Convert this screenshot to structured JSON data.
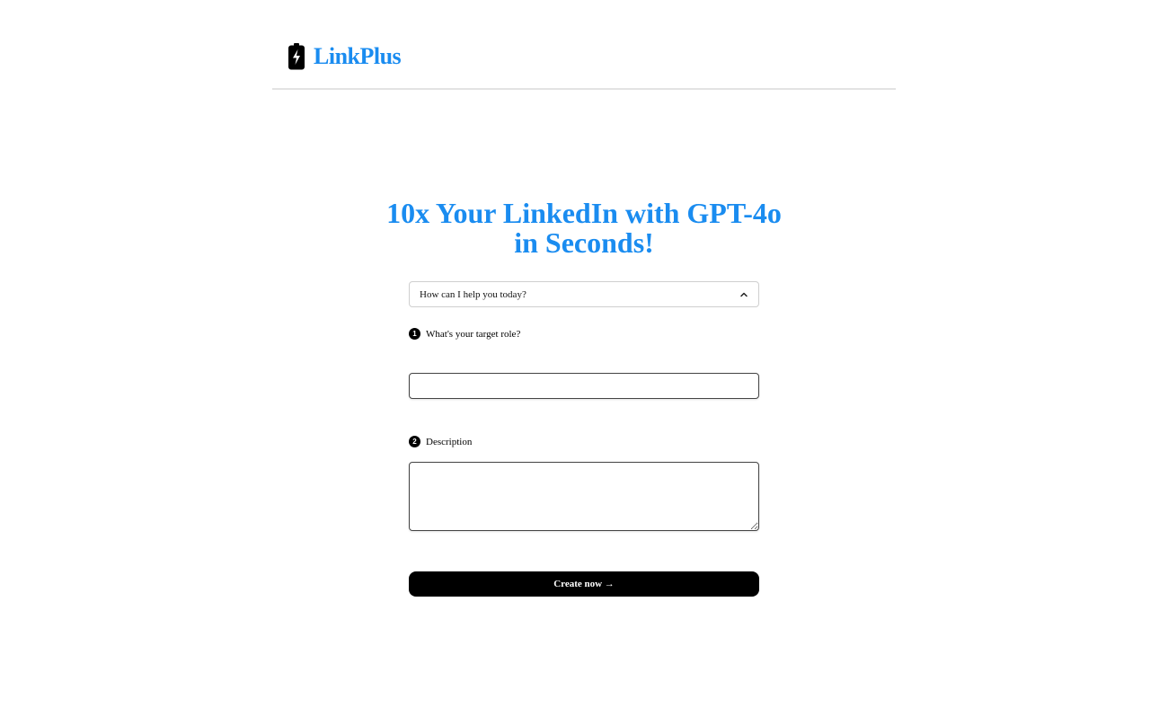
{
  "header": {
    "brand": "LinkPlus",
    "logo_icon": "battery-bolt-icon",
    "brand_color": "#1a8cf0"
  },
  "hero": {
    "line1": "10x Your LinkedIn with GPT-4o",
    "line2": "in Seconds!"
  },
  "form": {
    "select": {
      "selected": "How can I help you today?",
      "icon": "chevron-up-icon"
    },
    "step1": {
      "number": "1",
      "label": "What's your target role?",
      "value": ""
    },
    "step2": {
      "number": "2",
      "label": "Description",
      "value": ""
    },
    "submit_label": "Create now →"
  }
}
